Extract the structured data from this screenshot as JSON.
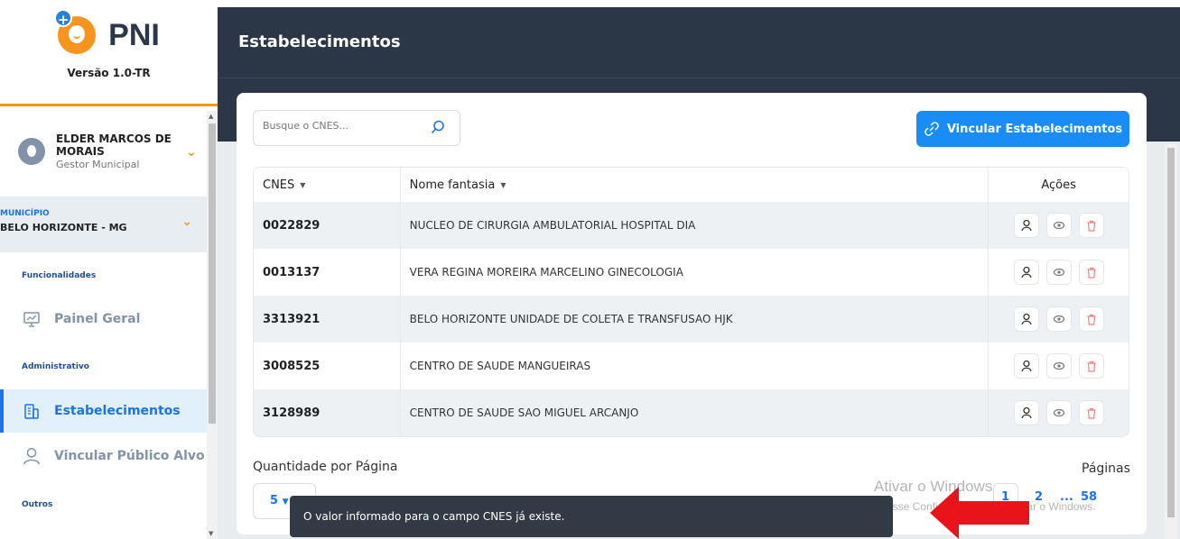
{
  "app": {
    "logo_text": "PNI",
    "version": "Versão 1.0-TR"
  },
  "user": {
    "name": "ELDER MARCOS DE MORAIS",
    "role": "Gestor Municipal"
  },
  "municipio": {
    "label": "MUNICÍPIO",
    "value": "BELO HORIZONTE - MG"
  },
  "sidebar": {
    "sections": [
      "Funcionalidades",
      "Administrativo",
      "Outros"
    ],
    "items": [
      {
        "label": "Painel Geral",
        "icon": "presentation-board-icon"
      },
      {
        "label": "Estabelecimentos",
        "icon": "building-icon",
        "active": true
      },
      {
        "label": "Vincular Público Alvo",
        "icon": "person-outline-icon"
      }
    ]
  },
  "header": {
    "title": "Estabelecimentos"
  },
  "search": {
    "placeholder": "Busque o CNES..."
  },
  "link_button": {
    "label": "Vincular Estabelecimentos",
    "icon": "link-icon"
  },
  "table": {
    "columns": [
      "CNES",
      "Nome fantasia",
      "Ações"
    ],
    "rows": [
      {
        "cnes": "0022829",
        "nome": "NUCLEO DE CIRURGIA AMBULATORIAL HOSPITAL DIA"
      },
      {
        "cnes": "0013137",
        "nome": "VERA REGINA MOREIRA MARCELINO GINECOLOGIA"
      },
      {
        "cnes": "3313921",
        "nome": "BELO HORIZONTE UNIDADE DE COLETA E TRANSFUSAO HJK"
      },
      {
        "cnes": "3008525",
        "nome": "CENTRO DE SAUDE MANGUEIRAS"
      },
      {
        "cnes": "3128989",
        "nome": "CENTRO DE SAUDE SAO MIGUEL ARCANJO"
      }
    ]
  },
  "pagination": {
    "per_page_label": "Quantidade por Página",
    "per_page_value": "5",
    "pages_label": "Páginas",
    "pages": [
      "1",
      "2",
      "...",
      "58"
    ]
  },
  "toast": {
    "message": "O valor informado para o campo CNES já existe."
  },
  "watermark": {
    "title": "Ativar o Windows",
    "subtitle": "Acesse Configurações para ativar o Windows."
  },
  "colors": {
    "primary": "#1a8cf5",
    "sidebar_accent": "#f7941d",
    "header_bg": "#2b3646",
    "toast_bg": "#323a45"
  }
}
